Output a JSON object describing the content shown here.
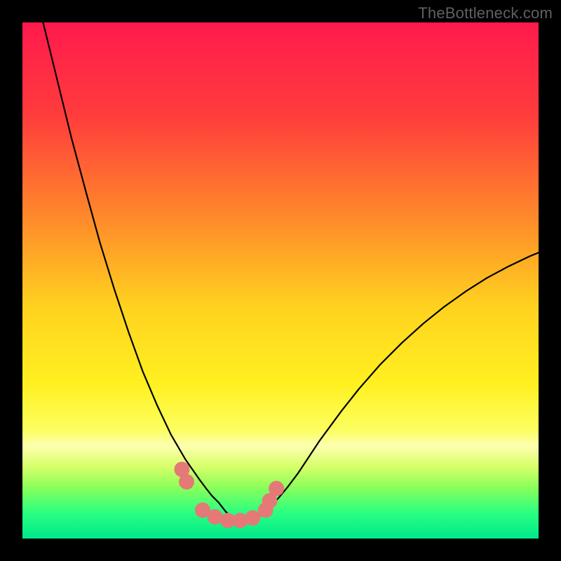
{
  "watermark": "TheBottleneck.com",
  "chart_data": {
    "type": "line",
    "title": "",
    "xlabel": "",
    "ylabel": "",
    "xlim": [
      0,
      100
    ],
    "ylim": [
      0,
      100
    ],
    "grid": false,
    "legend": false,
    "background_gradient_stops": [
      {
        "offset": 0.0,
        "color": "#ff1a4d"
      },
      {
        "offset": 0.18,
        "color": "#ff3c3c"
      },
      {
        "offset": 0.38,
        "color": "#ff8a2a"
      },
      {
        "offset": 0.55,
        "color": "#ffd21f"
      },
      {
        "offset": 0.7,
        "color": "#fff020"
      },
      {
        "offset": 0.79,
        "color": "#fcff60"
      },
      {
        "offset": 0.82,
        "color": "#fdffb0"
      },
      {
        "offset": 0.86,
        "color": "#d8ff6a"
      },
      {
        "offset": 0.9,
        "color": "#8cff5a"
      },
      {
        "offset": 0.95,
        "color": "#2aff80"
      },
      {
        "offset": 1.0,
        "color": "#00e88c"
      }
    ],
    "series": [
      {
        "name": "left-curve",
        "stroke": "#000000",
        "x": [
          4.0,
          6.8,
          9.5,
          12.3,
          15.0,
          17.8,
          20.6,
          23.3,
          26.1,
          28.8,
          31.6,
          34.4,
          35.6,
          36.7,
          38.0,
          39.4,
          40.7,
          43.1
        ],
        "y": [
          100.0,
          88.6,
          77.6,
          67.2,
          57.4,
          48.3,
          39.9,
          32.4,
          25.8,
          20.1,
          15.3,
          11.3,
          9.7,
          8.3,
          7.0,
          5.2,
          4.1,
          3.0
        ]
      },
      {
        "name": "right-curve",
        "stroke": "#000000",
        "x": [
          43.1,
          45.2,
          47.3,
          49.3,
          51.4,
          53.5,
          57.6,
          61.8,
          65.2,
          69.3,
          73.5,
          77.6,
          81.7,
          85.9,
          90.0,
          94.1,
          98.3,
          100.0
        ],
        "y": [
          3.0,
          4.0,
          5.5,
          7.5,
          10.0,
          12.8,
          19.0,
          24.7,
          29.0,
          33.7,
          37.9,
          41.6,
          44.9,
          47.9,
          50.5,
          52.7,
          54.7,
          55.4
        ]
      }
    ],
    "points": {
      "name": "bottleneck-markers",
      "fill": "#e57977",
      "r": 11,
      "x": [
        30.9,
        31.8,
        34.9,
        37.3,
        39.8,
        42.2,
        44.6,
        47.1,
        47.9,
        49.2
      ],
      "y": [
        13.4,
        11.0,
        5.5,
        4.2,
        3.5,
        3.5,
        4.0,
        5.5,
        7.3,
        9.7
      ]
    },
    "annotations": []
  }
}
